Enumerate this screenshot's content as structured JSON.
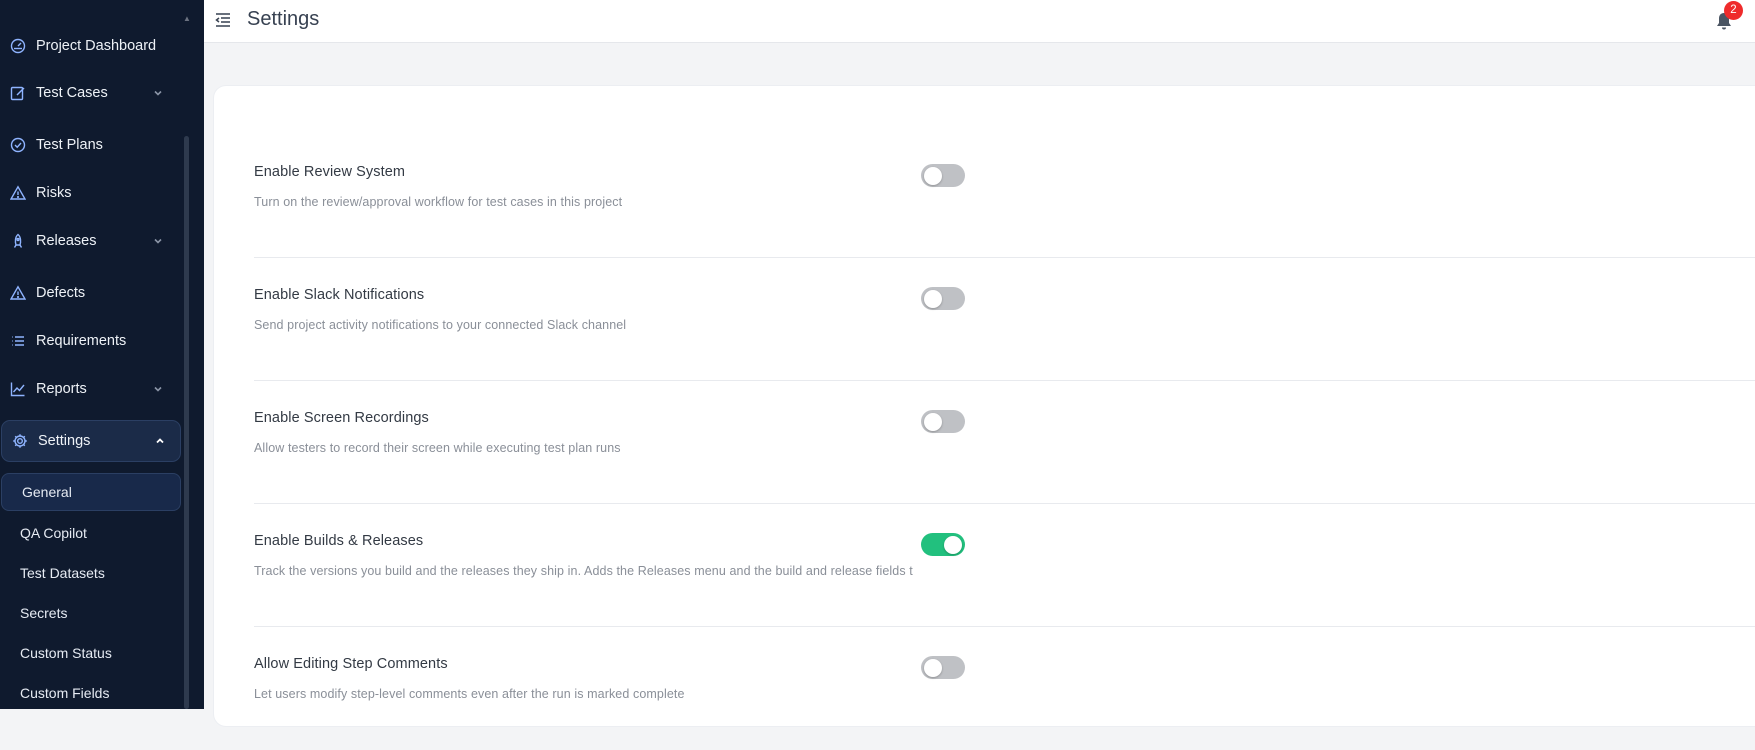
{
  "sidebar": {
    "items": [
      {
        "label": "Project Dashboard",
        "icon": "gauge-icon"
      },
      {
        "label": "Test Cases",
        "icon": "edit-icon",
        "expandable": true
      },
      {
        "label": "Test Plans",
        "icon": "check-circle-icon"
      },
      {
        "label": "Risks",
        "icon": "warning-triangle-icon"
      },
      {
        "label": "Releases",
        "icon": "rocket-icon",
        "expandable": true
      },
      {
        "label": "Defects",
        "icon": "warning-triangle-icon"
      },
      {
        "label": "Requirements",
        "icon": "list-icon"
      },
      {
        "label": "Reports",
        "icon": "line-chart-icon",
        "expandable": true
      },
      {
        "label": "Settings",
        "icon": "gear-icon",
        "expandable": true,
        "expanded": true
      }
    ],
    "settings_subitems": [
      {
        "label": "General",
        "active": true
      },
      {
        "label": "QA Copilot"
      },
      {
        "label": "Test Datasets"
      },
      {
        "label": "Secrets"
      },
      {
        "label": "Custom Status"
      },
      {
        "label": "Custom Fields"
      }
    ]
  },
  "header": {
    "title": "Settings",
    "notification_count": "2"
  },
  "settings": [
    {
      "title": "Enable Review System",
      "description": "Turn on the review/approval workflow for test cases in this project",
      "enabled": false
    },
    {
      "title": "Enable Slack Notifications",
      "description": "Send project activity notifications to your connected Slack channel",
      "enabled": false
    },
    {
      "title": "Enable Screen Recordings",
      "description": "Allow testers to record their screen while executing test plan runs",
      "enabled": false
    },
    {
      "title": "Enable Builds & Releases",
      "description": "Track the versions you build and the releases they ship in. Adds the Releases menu and the build and release fields t",
      "enabled": true
    },
    {
      "title": "Allow Editing Step Comments",
      "description": "Let users modify step-level comments even after the run is marked complete",
      "enabled": false
    }
  ],
  "colors": {
    "sidebar_bg": "#0f1a2e",
    "accent_icon": "#8fb4ff",
    "toggle_on": "#22c07e",
    "toggle_off": "#bfc1c5",
    "badge": "#ef2b2b"
  }
}
